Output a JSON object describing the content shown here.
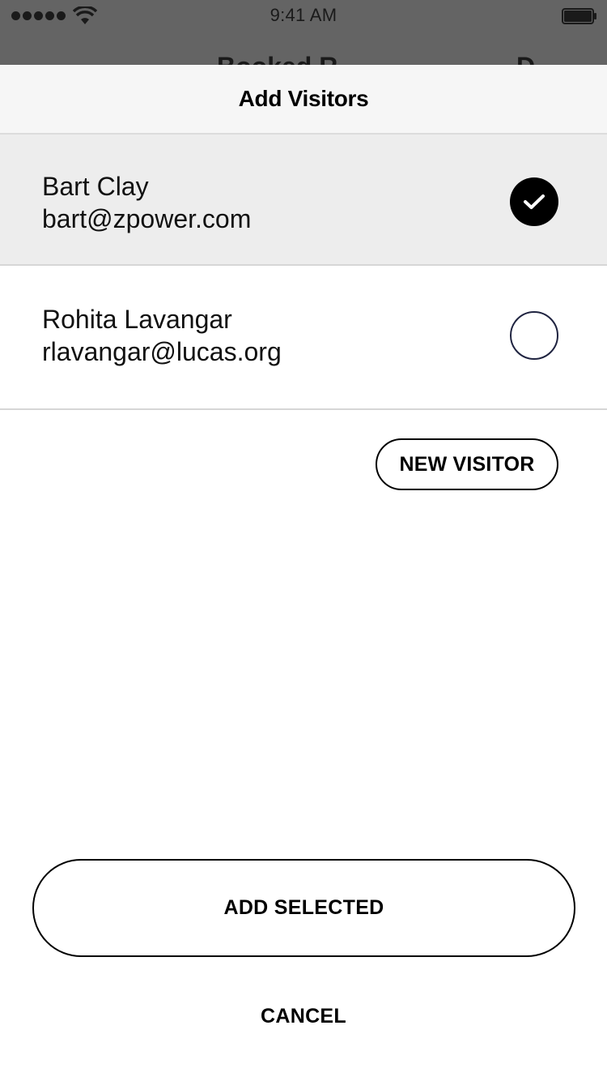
{
  "status_bar": {
    "time": "9:41 AM",
    "signal_icon": "signal-dots-icon",
    "wifi_icon": "wifi-icon",
    "battery_icon": "battery-icon"
  },
  "backdrop": {
    "title_fragment_left": "Booked R",
    "title_fragment_right": "D"
  },
  "sheet": {
    "title": "Add Visitors"
  },
  "visitors": [
    {
      "name": "Bart Clay",
      "email": "bart@zpower.com",
      "selected": true
    },
    {
      "name": "Rohita Lavangar",
      "email": "rlavangar@lucas.org",
      "selected": false
    }
  ],
  "actions": {
    "new_visitor_label": "NEW VISITOR",
    "add_selected_label": "ADD SELECTED",
    "cancel_label": "CANCEL"
  },
  "colors": {
    "backdrop": "#646464",
    "header_bg": "#f6f6f6",
    "selected_row_bg": "#ededed",
    "accent": "#000000",
    "radio_border": "#1f2340"
  }
}
